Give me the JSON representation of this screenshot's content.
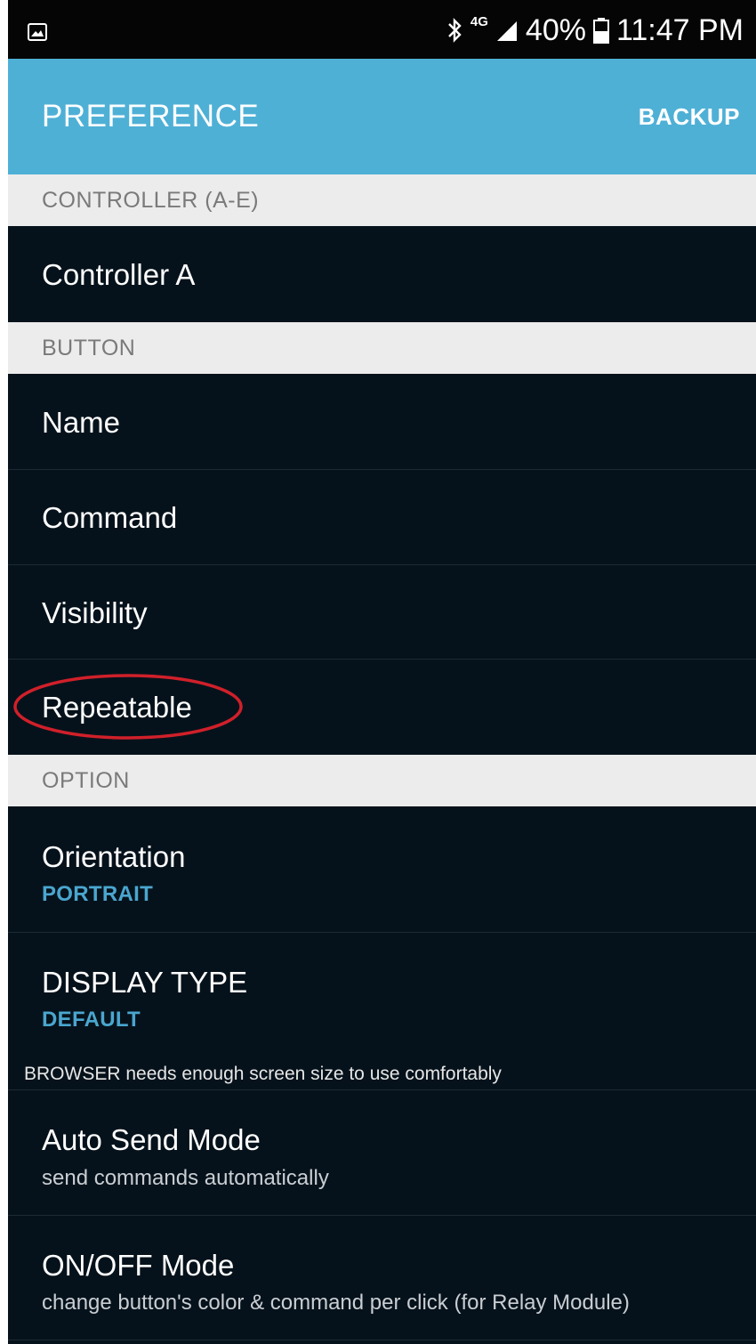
{
  "status_bar": {
    "left_icon": "image-notification-icon",
    "bluetooth_icon": "bluetooth-icon",
    "network_label": "4G",
    "signal_icon": "signal-icon",
    "battery_percent": "40%",
    "battery_icon": "battery-icon",
    "time": "11:47 PM"
  },
  "app_bar": {
    "title": "PREFERENCE",
    "action": "BACKUP",
    "color": "#4fb0d6"
  },
  "sections": {
    "controller": {
      "header": "CONTROLLER (A-E)",
      "items": [
        {
          "title": "Controller A"
        }
      ]
    },
    "button": {
      "header": "BUTTON",
      "items": [
        {
          "title": "Name"
        },
        {
          "title": "Command"
        },
        {
          "title": "Visibility"
        },
        {
          "title": "Repeatable"
        }
      ]
    },
    "option": {
      "header": "OPTION",
      "items": [
        {
          "title": "Orientation",
          "summary": "PORTRAIT"
        },
        {
          "title": "DISPLAY TYPE",
          "summary": "DEFAULT",
          "note": "BROWSER needs enough screen size to use comfortably"
        },
        {
          "title": "Auto Send Mode",
          "summary": "send commands automatically"
        },
        {
          "title": "ON/OFF Mode",
          "summary": "change button's color & command per click (for Relay Module)"
        }
      ]
    }
  },
  "annotation": {
    "highlight_color": "#d0202a",
    "highlighted_item": "Repeatable"
  }
}
